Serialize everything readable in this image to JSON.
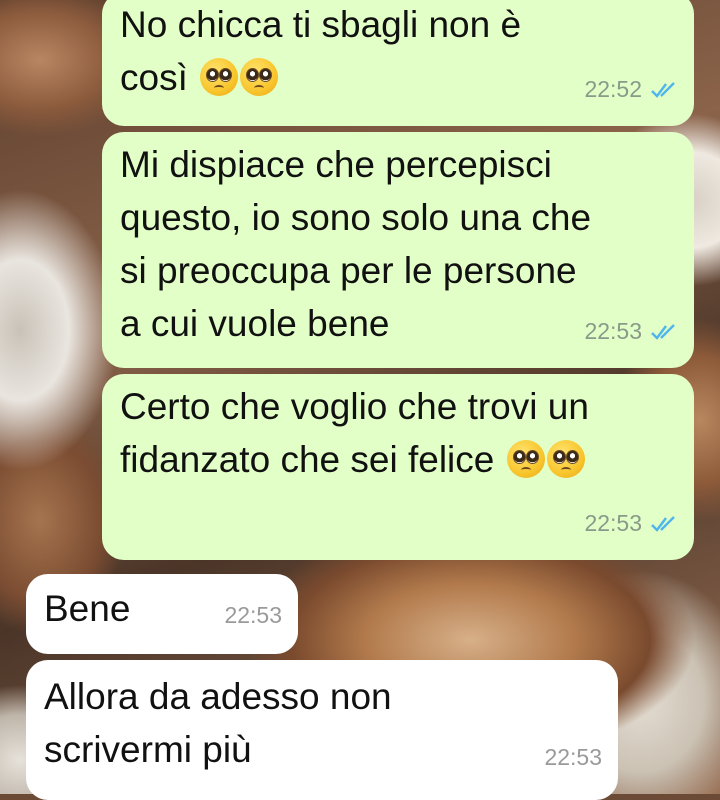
{
  "conversation": {
    "messages": [
      {
        "direction": "outgoing",
        "text": "No chicca ti sbagli non è così",
        "emoji": "pleading-face-emoji x2",
        "time": "22:52",
        "status": "read"
      },
      {
        "direction": "outgoing",
        "text": "Mi dispiace che percepisci questo, io sono solo una che si preoccupa per le persone a cui vuole bene",
        "time": "22:53",
        "status": "read"
      },
      {
        "direction": "outgoing",
        "text": "Certo che voglio che trovi un fidanzato che sei felice",
        "emoji": "pleading-face-emoji x2",
        "time": "22:53",
        "status": "read"
      },
      {
        "direction": "incoming",
        "text": "Bene",
        "time": "22:53"
      },
      {
        "direction": "incoming",
        "text": "Allora da adesso non scrivermi più",
        "time": "22:53"
      }
    ],
    "m1_line1": "No chicca ti sbagli non è",
    "m1_line2": "così",
    "m2_line1": "Mi dispiace che percepisci",
    "m2_line2": "questo, io sono solo una che",
    "m2_line3": "si preoccupa per le persone",
    "m2_line4": "a cui vuole bene",
    "m3_line1": "Certo che voglio che trovi un",
    "m3_line2": "fidanzato che sei felice",
    "m4_line1": "Bene",
    "m5_line1": "Allora da adesso non",
    "m5_line2": "scrivermi più"
  },
  "colors": {
    "outgoing_bubble": "#e2ffc7",
    "incoming_bubble": "#ffffff",
    "read_ticks": "#4fb6ec",
    "timestamp": "#8a9a8a"
  },
  "icons": [
    "double-check-icon",
    "pleading-face-emoji"
  ]
}
